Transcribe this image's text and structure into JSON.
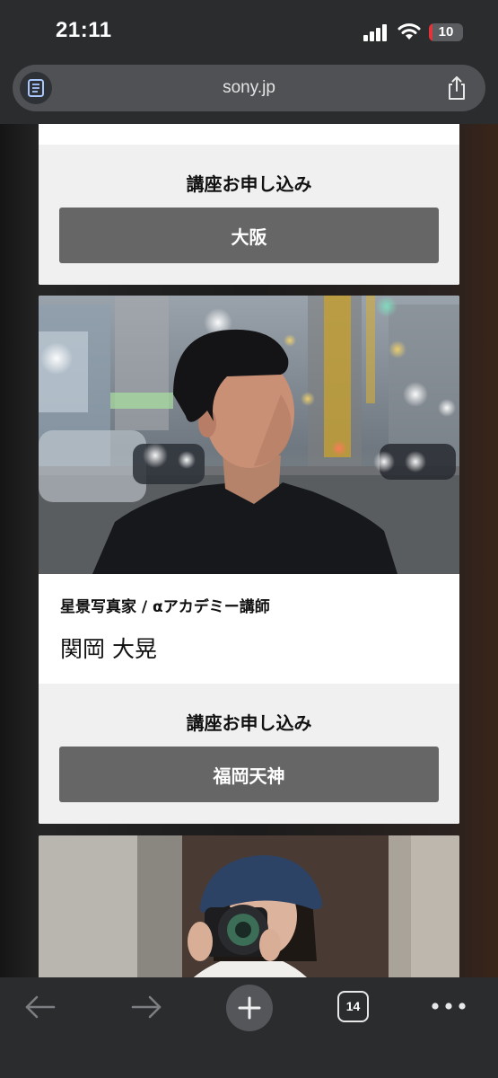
{
  "status_bar": {
    "time": "21:11",
    "battery_level": "10",
    "battery_fraction": 0.1,
    "battery_color": "#e5333a"
  },
  "address_bar": {
    "url": "sony.jp",
    "reader_icon": "reader-icon",
    "share_icon": "share-icon"
  },
  "cards": [
    {
      "apply_title": "講座お申し込み",
      "apply_button": "大阪"
    },
    {
      "role": "星景写真家 / αアカデミー講師",
      "name": "関岡 大晃",
      "apply_title": "講座お申し込み",
      "apply_button": "福岡天神"
    }
  ],
  "toolbar": {
    "tab_count": "14",
    "icons": [
      "back-arrow-icon",
      "forward-arrow-icon",
      "plus-icon",
      "tabs-icon",
      "more-icon"
    ]
  },
  "colors": {
    "chrome": "#2b2c2e",
    "button_gray": "#666666",
    "apply_bg": "#f0f0f0"
  }
}
